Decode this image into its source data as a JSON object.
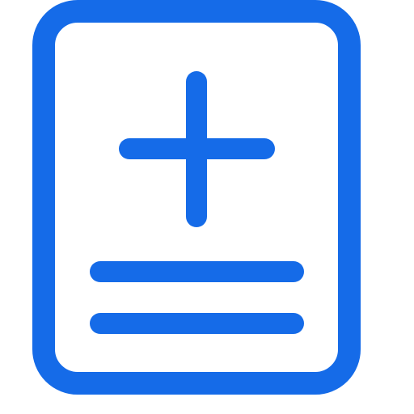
{
  "icon": {
    "name": "document-add-icon",
    "accent": "#156BE8",
    "background": "#FFFFFF"
  }
}
